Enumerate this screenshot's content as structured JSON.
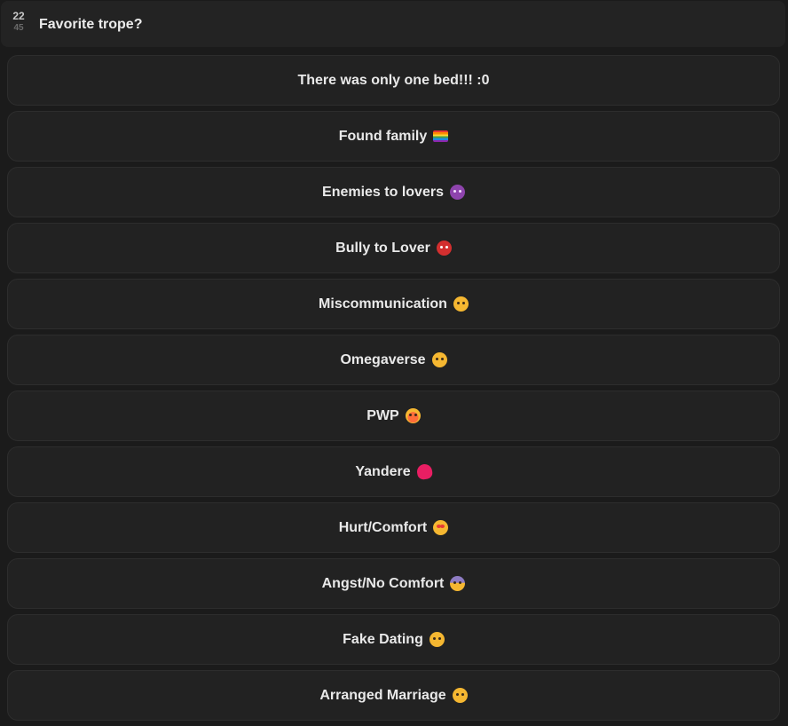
{
  "header": {
    "count_top": "22",
    "count_bottom": "45",
    "title": "Favorite trope?"
  },
  "options": [
    {
      "label": "There was only one bed!!! :0",
      "emoji": ""
    },
    {
      "label": "Found family",
      "emoji": "rainbow-flag-icon"
    },
    {
      "label": "Enemies to lovers",
      "emoji": "smiling-devil-icon"
    },
    {
      "label": "Bully to Lover",
      "emoji": "angry-face-icon"
    },
    {
      "label": "Miscommunication",
      "emoji": "flushed-face-icon"
    },
    {
      "label": "Omegaverse",
      "emoji": "flushed-face-icon"
    },
    {
      "label": "PWP",
      "emoji": "exploding-head-icon"
    },
    {
      "label": "Yandere",
      "emoji": "broken-heart-icon"
    },
    {
      "label": "Hurt/Comfort",
      "emoji": "heart-eyes-icon"
    },
    {
      "label": "Angst/No Comfort",
      "emoji": "screaming-face-icon"
    },
    {
      "label": "Fake Dating",
      "emoji": "flushed-face-icon"
    },
    {
      "label": "Arranged Marriage",
      "emoji": "drooling-face-icon"
    }
  ]
}
